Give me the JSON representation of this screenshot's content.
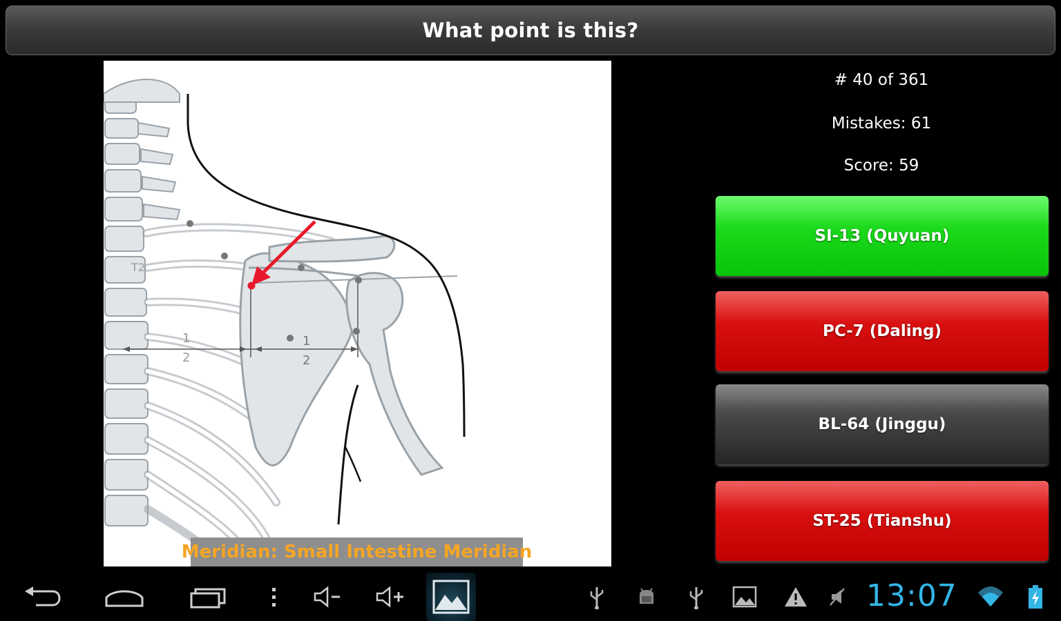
{
  "header": {
    "title": "What point is this?"
  },
  "stats": {
    "progress": "# 40 of 361",
    "mistakes": "Mistakes: 61",
    "score": "Score: 59"
  },
  "image": {
    "meridian": "Meridian: Small Intestine Meridian",
    "vertebra_label": "T2",
    "fraction_numerator": "1",
    "fraction_denominator": "2"
  },
  "answers": [
    {
      "label": "SI-13 (Quyuan)",
      "state": "correct",
      "color": "#14d414"
    },
    {
      "label": "PC-7 (Daling)",
      "state": "wrong",
      "color": "#d01010"
    },
    {
      "label": "BL-64 (Jinggu)",
      "state": "neutral",
      "color": "#3a3a3a"
    },
    {
      "label": "ST-25 (Tianshu)",
      "state": "wrong",
      "color": "#d01010"
    }
  ],
  "statusbar": {
    "time": "13:07",
    "icons": [
      "usb-icon",
      "android-debug-icon",
      "usb-icon",
      "image-notification-icon",
      "warning-icon",
      "no-sound-icon",
      "wifi-icon",
      "battery-charging-icon"
    ]
  },
  "navbar": {
    "icons": [
      "back-icon",
      "home-icon",
      "recent-apps-icon",
      "menu-icon",
      "volume-down-icon",
      "volume-up-icon",
      "gallery-icon"
    ]
  },
  "colors": {
    "accent": "#33b5e5",
    "meridian_text": "#f5a524",
    "marker": "#e8192c"
  }
}
